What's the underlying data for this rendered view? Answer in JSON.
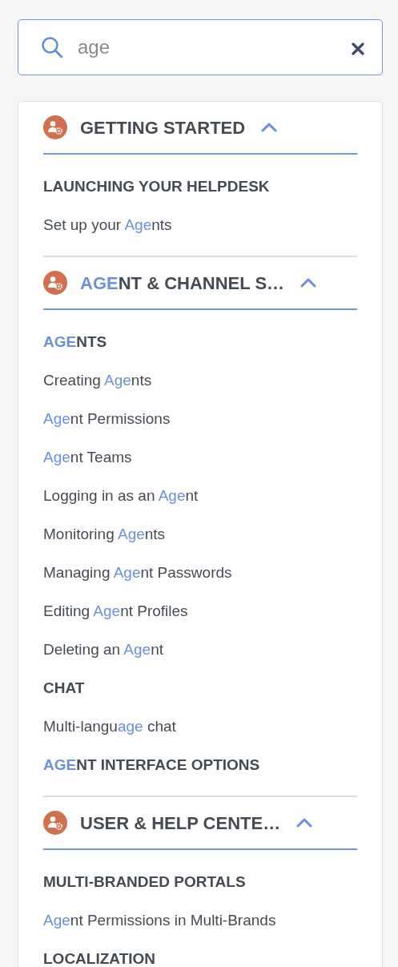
{
  "search": {
    "value": "age"
  },
  "sections": [
    {
      "title": [
        {
          "text": "GETTING STARTED",
          "match": false
        }
      ],
      "expanded": true,
      "groups": [
        {
          "heading": [
            {
              "text": "LAUNCHING YOUR HELPDESK",
              "match": false
            }
          ],
          "items": [
            [
              {
                "text": "Set up your ",
                "match": false
              },
              {
                "text": "Age",
                "match": true
              },
              {
                "text": "nts",
                "match": false
              }
            ]
          ]
        }
      ]
    },
    {
      "title": [
        {
          "text": "AGE",
          "match": true
        },
        {
          "text": "NT & CHANNEL S…",
          "match": false
        }
      ],
      "expanded": true,
      "groups": [
        {
          "heading": [
            {
              "text": "AGE",
              "match": true
            },
            {
              "text": "NTS",
              "match": false
            }
          ],
          "items": [
            [
              {
                "text": "Creating ",
                "match": false
              },
              {
                "text": "Age",
                "match": true
              },
              {
                "text": "nts",
                "match": false
              }
            ],
            [
              {
                "text": "Age",
                "match": true
              },
              {
                "text": "nt Permissions",
                "match": false
              }
            ],
            [
              {
                "text": "Age",
                "match": true
              },
              {
                "text": "nt Teams",
                "match": false
              }
            ],
            [
              {
                "text": "Logging in as an ",
                "match": false
              },
              {
                "text": "Age",
                "match": true
              },
              {
                "text": "nt",
                "match": false
              }
            ],
            [
              {
                "text": "Monitoring ",
                "match": false
              },
              {
                "text": "Age",
                "match": true
              },
              {
                "text": "nts",
                "match": false
              }
            ],
            [
              {
                "text": "Managing ",
                "match": false
              },
              {
                "text": "Age",
                "match": true
              },
              {
                "text": "nt Passwords",
                "match": false
              }
            ],
            [
              {
                "text": "Editing ",
                "match": false
              },
              {
                "text": "Age",
                "match": true
              },
              {
                "text": "nt Profiles",
                "match": false
              }
            ],
            [
              {
                "text": "Deleting an ",
                "match": false
              },
              {
                "text": "Age",
                "match": true
              },
              {
                "text": "nt",
                "match": false
              }
            ]
          ]
        },
        {
          "heading": [
            {
              "text": "CHAT",
              "match": false
            }
          ],
          "items": [
            [
              {
                "text": "Multi-langu",
                "match": false
              },
              {
                "text": "age",
                "match": true
              },
              {
                "text": " chat",
                "match": false
              }
            ]
          ]
        },
        {
          "heading": [
            {
              "text": "AGE",
              "match": true
            },
            {
              "text": "NT INTERFACE OPTIONS",
              "match": false
            }
          ]
        }
      ]
    },
    {
      "title": [
        {
          "text": "USER & HELP CENTE…",
          "match": false
        }
      ],
      "expanded": true,
      "groups": [
        {
          "heading": [
            {
              "text": "MULTI-BRANDED PORTALS",
              "match": false
            }
          ],
          "items": [
            [
              {
                "text": "Age",
                "match": true
              },
              {
                "text": "nt Permissions in Multi-Brands",
                "match": false
              }
            ]
          ]
        },
        {
          "heading": [
            {
              "text": "LOCALIZATION",
              "match": false
            }
          ]
        }
      ]
    }
  ]
}
